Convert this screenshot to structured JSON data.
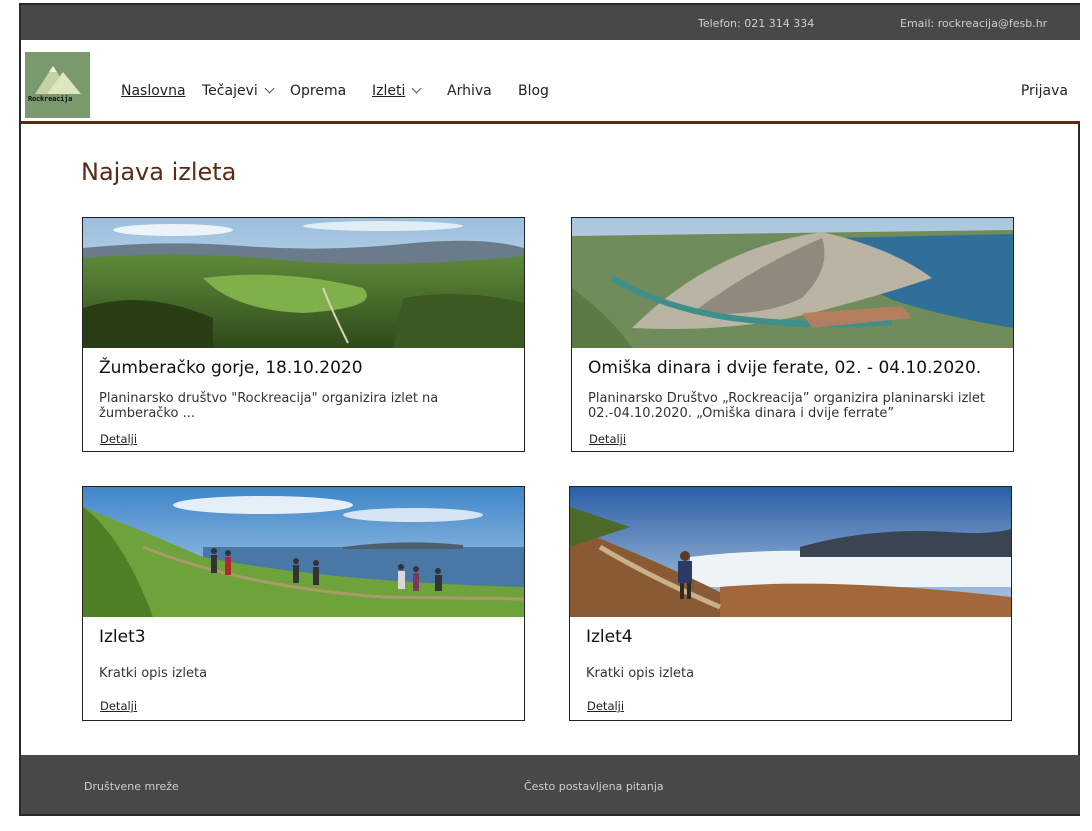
{
  "topbar": {
    "phone": "Telefon: 021 314 334",
    "email": "Email: rockreacija@fesb.hr"
  },
  "header": {
    "logo_text": "Rockreacija",
    "nav": [
      {
        "label": "Naslovna",
        "active": true
      },
      {
        "label": "Tečajevi",
        "dropdown": true
      },
      {
        "label": "Oprema"
      },
      {
        "label": "Izleti",
        "active": true,
        "dropdown": true
      },
      {
        "label": "Arhiva"
      },
      {
        "label": "Blog"
      }
    ],
    "login": "Prijava"
  },
  "main": {
    "title": "Najava izleta",
    "cards": [
      {
        "title": "Žumberačko gorje, 18.10.2020",
        "description": "Planinarsko društvo \"Rockreacija\" organizira izlet na žumberačko ...",
        "link": "Detalji",
        "image": "green-hills-aerial"
      },
      {
        "title": "Omiška dinara i dvije ferate, 02. - 04.10.2020.",
        "description": "Planinarsko Društvo „Rockreacija” organizira planinarski izlet 02.-04.10.2020. „Omiška dinara i dvije ferrate”",
        "link": "Detalji",
        "image": "coastal-mountain-aerial"
      },
      {
        "title": "Izlet3",
        "description": "Kratki opis izleta",
        "link": "Detalji",
        "image": "hikers-on-coastal-meadow"
      },
      {
        "title": "Izlet4",
        "description": "Kratki opis izleta",
        "link": "Detalji",
        "image": "hiker-above-clouds"
      }
    ]
  },
  "footer": {
    "social": "Društvene mreže",
    "faq": "Često postavljena pitanja"
  },
  "colors": {
    "topbar": "#484848",
    "accent": "#5a2a12",
    "logo_bg": "#7a9a6e"
  }
}
